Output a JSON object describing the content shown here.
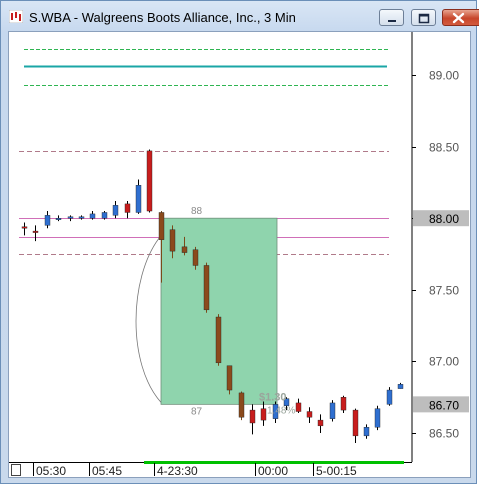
{
  "window": {
    "title": "S.WBA - Walgreens Boots Alliance, Inc., 3 Min",
    "buttons": [
      "minimize",
      "maximize",
      "close"
    ]
  },
  "chart_data": {
    "type": "candlestick",
    "ylim": [
      86.3,
      89.2
    ],
    "y_ticks": [
      "89.00",
      "88.50",
      "88.00",
      "87.50",
      "87.00",
      "86.50"
    ],
    "y_tick_values": [
      89.0,
      88.5,
      88.0,
      87.5,
      87.0,
      86.5
    ],
    "price_markers": [
      {
        "label": "88.00",
        "value": 88.0
      },
      {
        "label": "86.70",
        "value": 86.7
      }
    ],
    "x_ticks": [
      "05:30",
      "05:45",
      "4-23:30",
      "00:00",
      "5-00:15"
    ],
    "zone": {
      "top_label": "88",
      "bottom_label": "87",
      "top": 88.0,
      "bottom": 86.7,
      "color": "#8fd4ad"
    },
    "zone_overlay_text": [
      "$1.30",
      "1.48%"
    ],
    "colors": {
      "up": "#2f6fd0",
      "down": "#c81d1d",
      "down_wick": "#7a4a1a",
      "teal_line": "#1aa6a6",
      "green_dash": "#2fb552",
      "pink_line": "#d06fb8",
      "dash_gray": "#b07a8a",
      "marker_bg": "#bdbdbd",
      "grid_green": "#00c000"
    },
    "candles": [
      {
        "o": 87.94,
        "h": 87.97,
        "l": 87.88,
        "c": 87.93
      },
      {
        "o": 87.91,
        "h": 87.95,
        "l": 87.84,
        "c": 87.9
      },
      {
        "o": 87.95,
        "h": 88.05,
        "l": 87.93,
        "c": 88.02
      },
      {
        "o": 88.0,
        "h": 88.02,
        "l": 87.98,
        "c": 88.0
      },
      {
        "o": 88.0,
        "h": 88.02,
        "l": 87.98,
        "c": 88.01
      },
      {
        "o": 88.0,
        "h": 88.02,
        "l": 87.99,
        "c": 88.01
      },
      {
        "o": 88.0,
        "h": 88.05,
        "l": 87.99,
        "c": 88.03
      },
      {
        "o": 88.0,
        "h": 88.05,
        "l": 87.99,
        "c": 88.04
      },
      {
        "o": 88.02,
        "h": 88.12,
        "l": 88.0,
        "c": 88.09
      },
      {
        "o": 88.1,
        "h": 88.12,
        "l": 88.0,
        "c": 88.04
      },
      {
        "o": 88.04,
        "h": 88.27,
        "l": 88.03,
        "c": 88.23
      },
      {
        "o": 88.47,
        "h": 88.48,
        "l": 88.04,
        "c": 88.05
      },
      {
        "o": 88.04,
        "h": 88.05,
        "l": 87.55,
        "c": 87.85
      },
      {
        "o": 87.92,
        "h": 87.95,
        "l": 87.72,
        "c": 87.77
      },
      {
        "o": 87.8,
        "h": 87.87,
        "l": 87.74,
        "c": 87.76
      },
      {
        "o": 87.78,
        "h": 87.8,
        "l": 87.64,
        "c": 87.67
      },
      {
        "o": 87.67,
        "h": 87.69,
        "l": 87.34,
        "c": 87.36
      },
      {
        "o": 87.31,
        "h": 87.33,
        "l": 86.97,
        "c": 86.99
      },
      {
        "o": 86.97,
        "h": 86.97,
        "l": 86.77,
        "c": 86.8
      },
      {
        "o": 86.78,
        "h": 86.79,
        "l": 86.59,
        "c": 86.61
      },
      {
        "o": 86.66,
        "h": 86.7,
        "l": 86.49,
        "c": 86.57
      },
      {
        "o": 86.67,
        "h": 86.72,
        "l": 86.55,
        "c": 86.59
      },
      {
        "o": 86.6,
        "h": 86.72,
        "l": 86.57,
        "c": 86.7
      },
      {
        "o": 86.69,
        "h": 86.75,
        "l": 86.66,
        "c": 86.74
      },
      {
        "o": 86.71,
        "h": 86.74,
        "l": 86.64,
        "c": 86.65
      },
      {
        "o": 86.65,
        "h": 86.68,
        "l": 86.57,
        "c": 86.61
      },
      {
        "o": 86.59,
        "h": 86.63,
        "l": 86.5,
        "c": 86.55
      },
      {
        "o": 86.6,
        "h": 86.73,
        "l": 86.58,
        "c": 86.71
      },
      {
        "o": 86.75,
        "h": 86.76,
        "l": 86.64,
        "c": 86.66
      },
      {
        "o": 86.66,
        "h": 86.67,
        "l": 86.43,
        "c": 86.48
      },
      {
        "o": 86.48,
        "h": 86.56,
        "l": 86.46,
        "c": 86.54
      },
      {
        "o": 86.54,
        "h": 86.69,
        "l": 86.52,
        "c": 86.67
      },
      {
        "o": 86.7,
        "h": 86.82,
        "l": 86.69,
        "c": 86.8
      },
      {
        "o": 86.81,
        "h": 86.85,
        "l": 86.81,
        "c": 86.84
      }
    ],
    "horizontal_lines": [
      {
        "value": 89.18,
        "style": "dash",
        "color": "green_dash"
      },
      {
        "value": 89.06,
        "style": "solid",
        "color": "teal_line"
      },
      {
        "value": 88.93,
        "style": "dash",
        "color": "green_dash"
      },
      {
        "value": 88.47,
        "style": "dash",
        "color": "dash_gray"
      },
      {
        "value": 88.0,
        "style": "solid",
        "color": "pink_line"
      },
      {
        "value": 87.87,
        "style": "solid",
        "color": "pink_line"
      },
      {
        "value": 87.75,
        "style": "dash",
        "color": "dash_gray"
      }
    ]
  }
}
